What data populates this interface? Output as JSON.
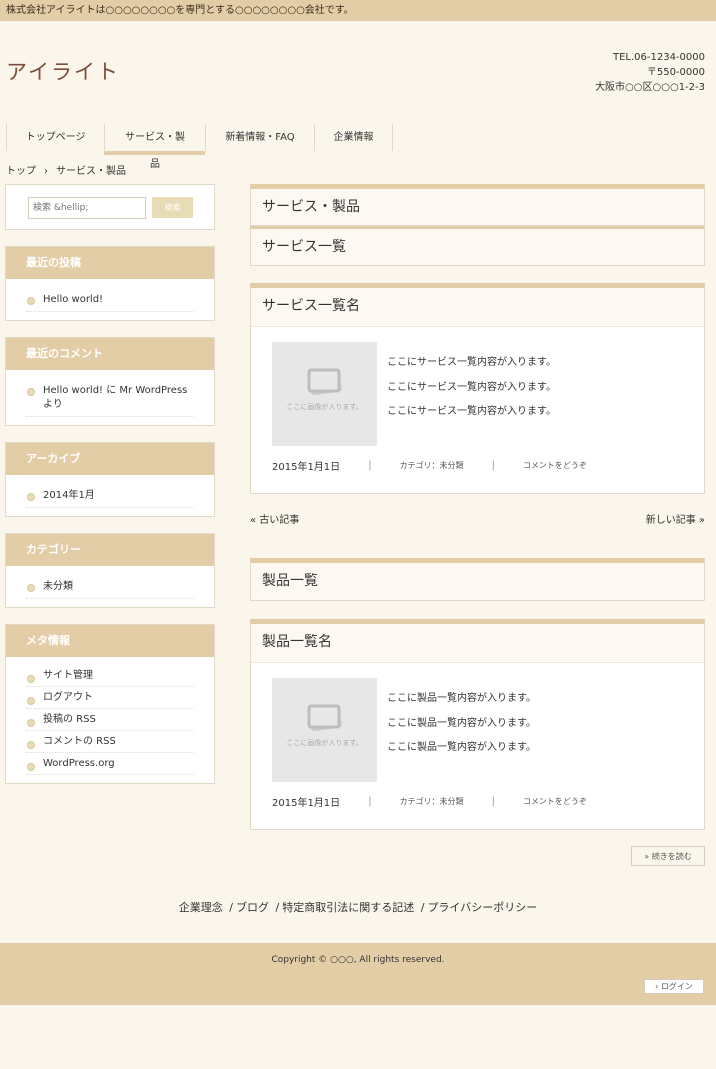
{
  "topbar": {
    "text": "株式会社アイライトは○○○○○○○○を専門とする○○○○○○○○会社です。"
  },
  "site": {
    "logo": "アイライト"
  },
  "contact": {
    "tel": "TEL.06-1234-0000",
    "zip": "〒550-0000",
    "address": "大阪市○○区○○○1-2-3"
  },
  "nav": {
    "items": [
      "トップページ",
      "サービス・製品",
      "新着情報・FAQ",
      "企業情報"
    ],
    "active": 1
  },
  "breadcrumb": {
    "home": "トップ",
    "sep": "›",
    "current": "サービス・製品"
  },
  "search": {
    "placeholder": "検索 &hellip;",
    "button": "検索"
  },
  "widgets": {
    "recent_posts": {
      "title": "最近の投稿",
      "items": [
        "Hello world!"
      ]
    },
    "recent_comments": {
      "title": "最近のコメント",
      "items": [
        "Hello world! に Mr WordPress より"
      ]
    },
    "archives": {
      "title": "アーカイブ",
      "items": [
        "2014年1月"
      ]
    },
    "categories": {
      "title": "カテゴリー",
      "items": [
        "未分類"
      ]
    },
    "meta": {
      "title": "メタ情報",
      "items": [
        "サイト管理",
        "ログアウト",
        "投稿の RSS",
        "コメントの RSS",
        "WordPress.org"
      ]
    }
  },
  "main": {
    "page_title": "サービス・製品",
    "services": {
      "heading": "サービス一覧",
      "post_title": "サービス一覧名",
      "thumb_caption": "ここに画像が入ります。",
      "lines": [
        "ここにサービス一覧内容が入ります。",
        "ここにサービス一覧内容が入ります。",
        "ここにサービス一覧内容が入ります。"
      ],
      "date": "2015年1月1日",
      "category": "カテゴリ：未分類",
      "comment": "コメントをどうぞ"
    },
    "pager": {
      "older": "« 古い記事",
      "newer": "新しい記事 »"
    },
    "products": {
      "heading": "製品一覧",
      "post_title": "製品一覧名",
      "thumb_caption": "ここに画像が入ります。",
      "lines": [
        "ここに製品一覧内容が入ります。",
        "ここに製品一覧内容が入ります。",
        "ここに製品一覧内容が入ります。"
      ],
      "date": "2015年1月1日",
      "category": "カテゴリ：未分類",
      "comment": "コメントをどうぞ"
    },
    "more_button": "» 続きを読む"
  },
  "footer": {
    "links": [
      "企業理念",
      "ブログ",
      "特定商取引法に関する記述",
      "プライバシーポリシー"
    ],
    "separator": "/",
    "copyright": "Copyright © ○○○, All rights reserved.",
    "login": "› ログイン"
  },
  "colors": {
    "accent": "#e3cda7",
    "background": "#fbf6ec",
    "logo": "#7a4e3a"
  }
}
